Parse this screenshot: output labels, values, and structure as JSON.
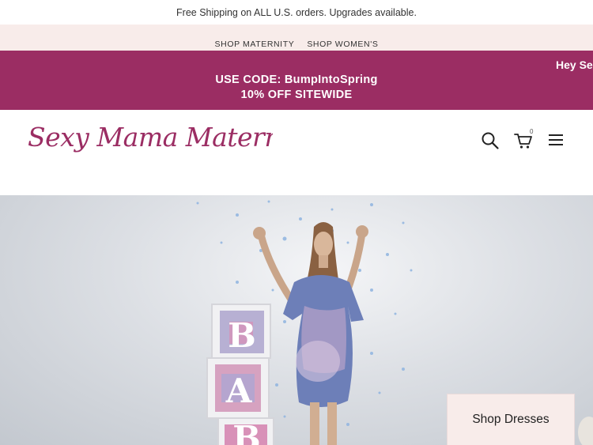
{
  "topbar": {
    "shipping_text": "Free Shipping on ALL U.S. orders. Upgrades available."
  },
  "shop_nav": {
    "items": [
      "SHOP MATERNITY",
      "SHOP WOMEN'S"
    ]
  },
  "promo": {
    "line1": "USE CODE: BumpIntoSpring",
    "line2": "10% OFF SITEWIDE",
    "marquee_text": "Hey Sex",
    "bg_color": "#9b2d63"
  },
  "header": {
    "logo_text": "Sexy Mama Maternity",
    "cart_count": "0",
    "icons": [
      "search-icon",
      "cart-icon",
      "menu-icon"
    ]
  },
  "hero": {
    "blocks": [
      "B",
      "A",
      "B"
    ],
    "cta_label": "Shop Dresses"
  },
  "colors": {
    "accent": "#9b2d63",
    "blush": "#f8ecea"
  }
}
